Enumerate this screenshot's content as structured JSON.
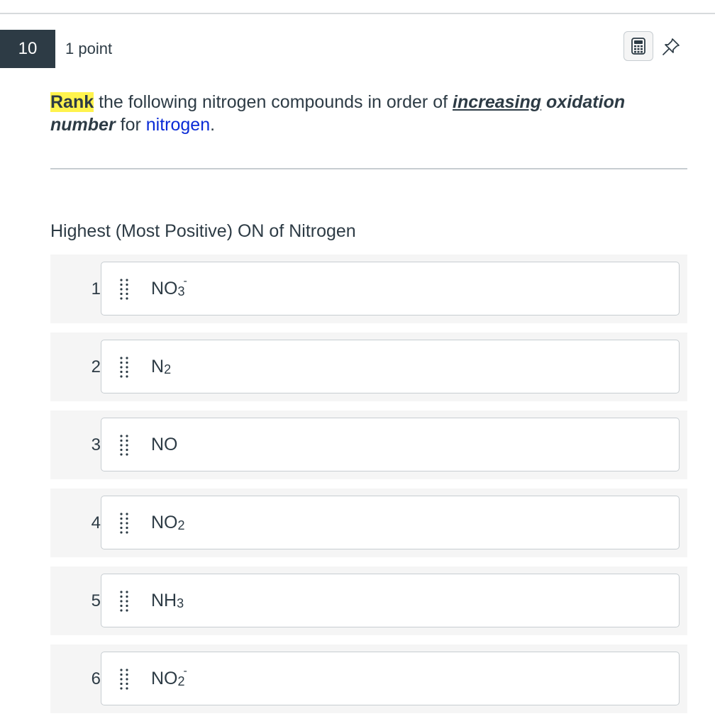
{
  "question": {
    "number": "10",
    "points": "1 point",
    "prompt": {
      "rank": "Rank",
      "text1": " the following nitrogen compounds in order of ",
      "increasing": "increasing",
      "space": " ",
      "oxidation": "oxidation",
      "number_word": "number",
      "text2": " for ",
      "nitrogen": "nitrogen",
      "period": "."
    },
    "rank_heading": "Highest (Most Positive) ON of Nitrogen"
  },
  "toolbar": {
    "calculator_icon": "calculator-icon",
    "pin_icon": "pin-icon"
  },
  "items": [
    {
      "rank": "1",
      "base": "NO",
      "sub": "3",
      "sup": "-"
    },
    {
      "rank": "2",
      "base": "N",
      "sub": "2",
      "sup": ""
    },
    {
      "rank": "3",
      "base": "NO",
      "sub": "",
      "sup": ""
    },
    {
      "rank": "4",
      "base": "NO",
      "sub": "2",
      "sup": ""
    },
    {
      "rank": "5",
      "base": "NH",
      "sub": "3",
      "sup": ""
    },
    {
      "rank": "6",
      "base": "NO",
      "sub": "2",
      "sup": "-"
    }
  ],
  "colors": {
    "header_badge": "#2d3b45",
    "highlight": "#fff34d",
    "link_blue": "#0a2bd6",
    "row_bg": "#f5f5f5"
  }
}
